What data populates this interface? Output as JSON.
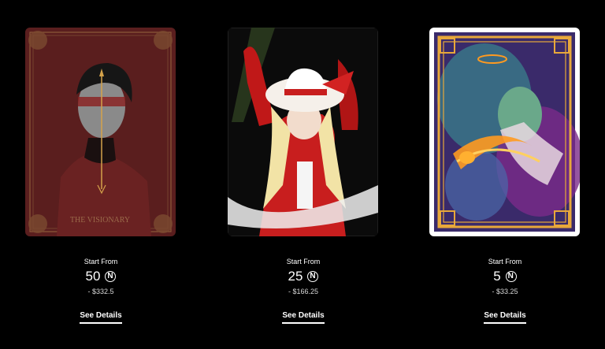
{
  "cards": [
    {
      "start_label": "Start From",
      "price": "50",
      "coin_symbol": "N",
      "usd": "- $332.5",
      "details_label": "See Details",
      "art_caption": "THE VISIONARY",
      "frame_color": "#8b5a3a"
    },
    {
      "start_label": "Start From",
      "price": "25",
      "coin_symbol": "N",
      "usd": "- $166.25",
      "details_label": "See Details",
      "frame_color": "#c81e1e"
    },
    {
      "start_label": "Start From",
      "price": "5",
      "coin_symbol": "N",
      "usd": "- $33.25",
      "details_label": "See Details",
      "frame_color": "#e8a83a"
    }
  ]
}
